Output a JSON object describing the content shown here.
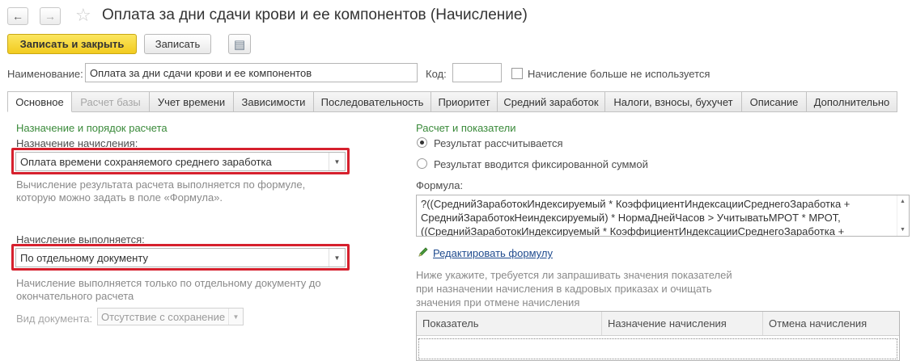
{
  "window": {
    "title": "Оплата за дни сдачи крови и ее компонентов (Начисление)",
    "back_icon": "←",
    "forward_icon": "→",
    "favorite_icon": "☆"
  },
  "toolbar": {
    "save_close_label": "Записать и закрыть",
    "save_label": "Записать",
    "list_icon": "▤"
  },
  "header": {
    "name_label": "Наименование:",
    "name_value": "Оплата за дни сдачи крови и ее компонентов",
    "code_label": "Код:",
    "code_value": "",
    "not_used_label": "Начисление больше не используется"
  },
  "tabs": [
    {
      "label": "Основное"
    },
    {
      "label": "Расчет базы"
    },
    {
      "label": "Учет времени"
    },
    {
      "label": "Зависимости"
    },
    {
      "label": "Последовательность"
    },
    {
      "label": "Приоритет"
    },
    {
      "label": "Средний заработок"
    },
    {
      "label": "Налоги, взносы, бухучет"
    },
    {
      "label": "Описание"
    },
    {
      "label": "Дополнительно"
    }
  ],
  "left": {
    "section_title": "Назначение и порядок расчета",
    "purpose_label": "Назначение начисления:",
    "purpose_value": "Оплата времени сохраняемого среднего заработка",
    "purpose_hint_1": "Вычисление результата расчета выполняется по формуле,",
    "purpose_hint_2": "которую можно задать в поле «Формула».",
    "execution_label": "Начисление выполняется:",
    "execution_value": "По отдельному документу",
    "execution_hint_1": "Начисление выполняется только по отдельному документу до",
    "execution_hint_2": "окончательного расчета",
    "doc_type_label": "Вид документа:",
    "doc_type_value": "Отсутствие с сохранение"
  },
  "right": {
    "section_title": "Расчет и показатели",
    "radio_calculated": "Результат рассчитывается",
    "radio_fixed": "Результат вводится фиксированной суммой",
    "formula_label": "Формула:",
    "formula_line_1": "?((СреднийЗаработокИндексируемый * КоэффициентИндексацииСреднегоЗаработка +",
    "formula_line_2": "СреднийЗаработокНеиндексируемый) * НормаДнейЧасов > УчитыватьМРОТ * МРОТ,",
    "formula_line_3": "((СреднийЗаработокИндексируемый * КоэффициентИндексацииСреднегоЗаработка +",
    "edit_formula_link": "Редактировать формулу",
    "indicators_hint_1": "Ниже укажите, требуется ли запрашивать значения показателей",
    "indicators_hint_2": "при назначении начисления в кадровых приказах и очищать",
    "indicators_hint_3": "значения при отмене начисления",
    "table_headers": [
      "Показатель",
      "Назначение начисления",
      "Отмена начисления"
    ]
  },
  "colors": {
    "accent_yellow": "#f5d327",
    "section_green": "#3a8a3a",
    "highlight_red": "#d6202d",
    "link_blue": "#1f4b8e"
  }
}
